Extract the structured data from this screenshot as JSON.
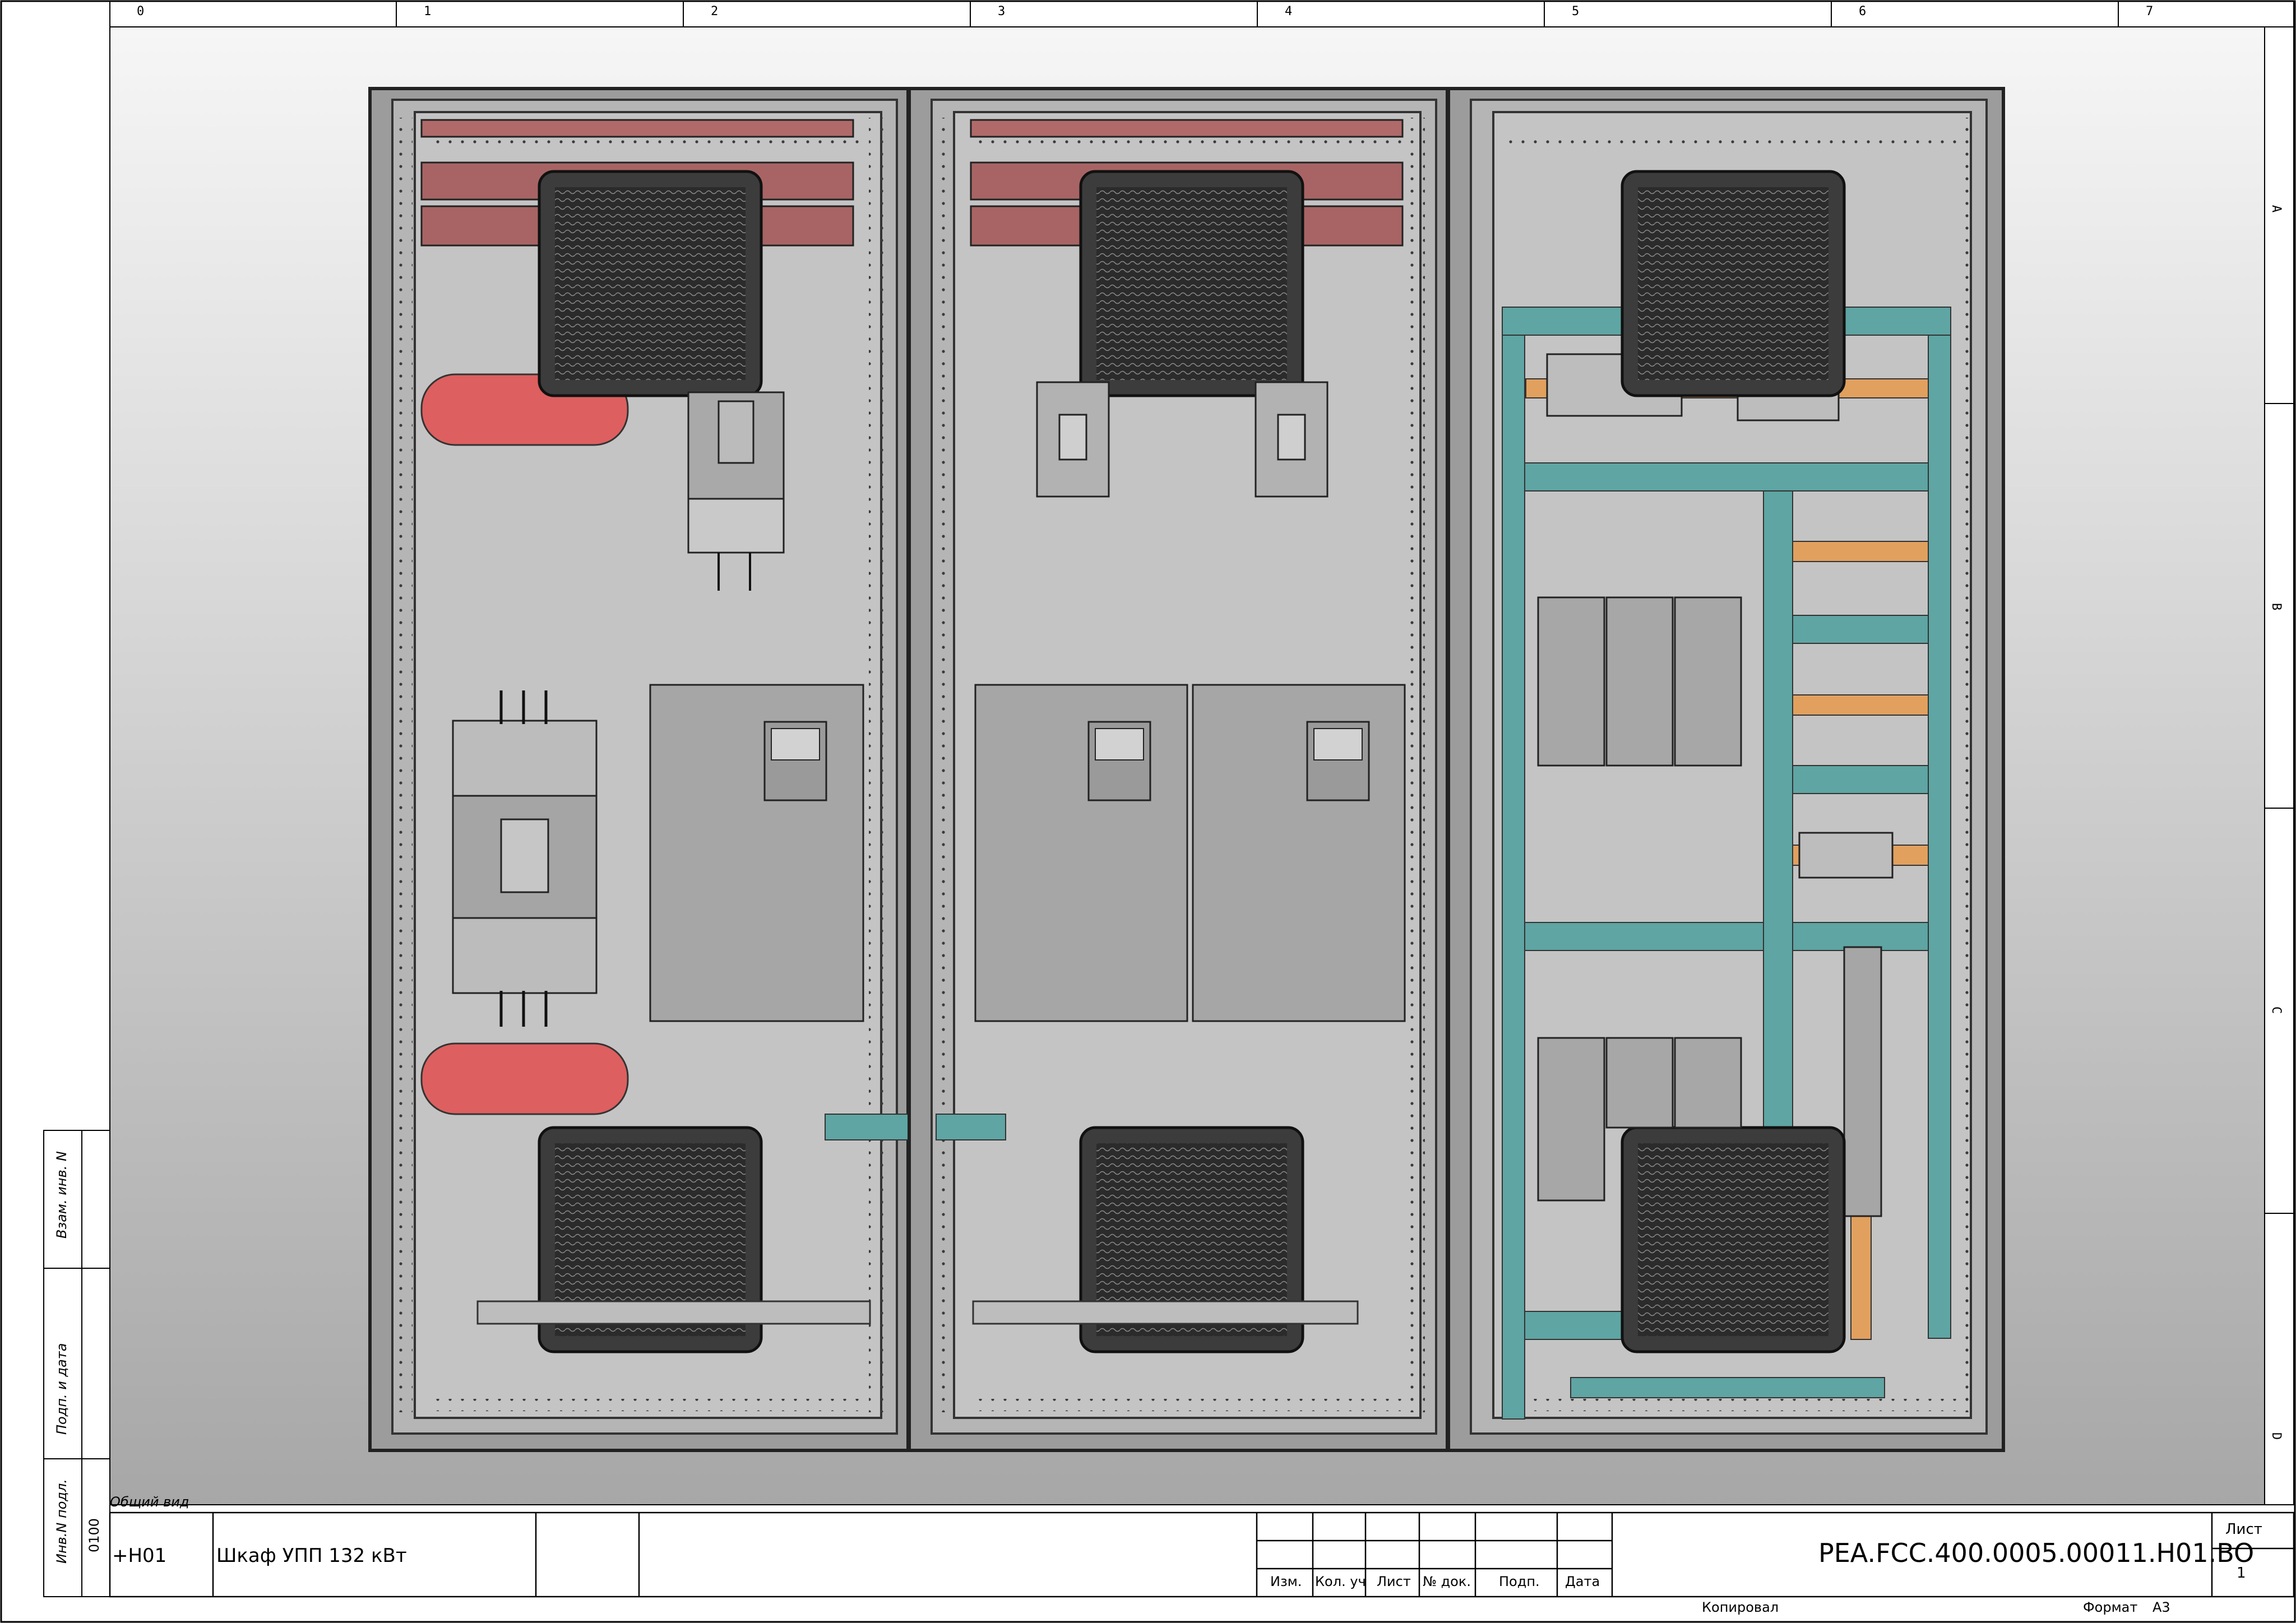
{
  "sheet": {
    "columns": [
      "0",
      "1",
      "2",
      "3",
      "4",
      "5",
      "6",
      "7"
    ],
    "rows": [
      "A",
      "B",
      "C",
      "D"
    ],
    "view_caption": "Общий вид"
  },
  "left_strip": {
    "labels": [
      "Взам. инв. N",
      "Подп. и дата",
      "Инв.N подл."
    ],
    "inv_value": "0100"
  },
  "title_block": {
    "location": "+H01",
    "title": "Шкаф УПП 132 кВт",
    "rev_headers": [
      "Изм.",
      "Кол. уч",
      "Лист",
      "№ док.",
      "Подп.",
      "Дата"
    ],
    "designation": "PEA.FCC.400.0005.00011.H01.BO",
    "sheet_label": "Лист",
    "sheet_number": "1",
    "copied_by_label": "Копировал",
    "format_label": "Формат",
    "format_value": "А3"
  },
  "colors": {
    "background_top": "#f4f4f4",
    "background_bottom": "#a9a9a9",
    "panel": "#c2c2c2",
    "frame_dark": "#3a3a3a",
    "busbar": "#b06a6a",
    "cable_red": "#de5f5f",
    "rail_teal": "#5ea5a3",
    "terminal_orange": "#e1a05e",
    "device_gray": "#a9a9a9"
  }
}
